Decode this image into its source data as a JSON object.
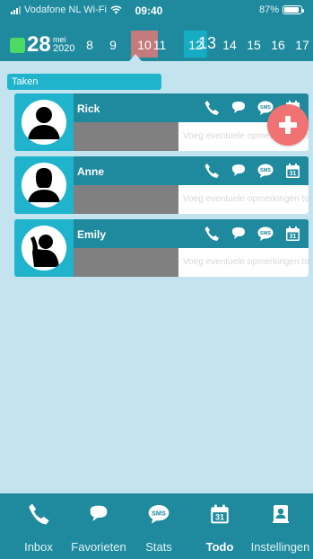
{
  "status": {
    "carrier": "Vodafone NL Wi-Fi",
    "time": "09:40",
    "battery": "87%",
    "battery_level": 0.87
  },
  "date_strip": {
    "today_day": "28",
    "today_month": "mei",
    "today_year": "2020",
    "days": [
      "8",
      "9",
      "10",
      "11",
      "12",
      "13",
      "14",
      "15",
      "16",
      "17"
    ]
  },
  "section": {
    "label": "Taken"
  },
  "contacts": [
    {
      "name": "Rick",
      "note_placeholder": "Voeg eventuele opmerkingen toe"
    },
    {
      "name": "Anne",
      "note_placeholder": "Voeg eventuele opmerkingen toe"
    },
    {
      "name": "Emily",
      "note_placeholder": "Voeg eventuele opmerkingen toe"
    }
  ],
  "icons": {
    "call": "phone-icon",
    "chat": "chat-bubble-icon",
    "sms": "sms-icon",
    "calendar": "calendar-icon",
    "add": "plus-icon",
    "settings": "contact-card-icon"
  },
  "calendar_icon_day": "31",
  "sms_text": "SMS",
  "tabs": [
    {
      "label": "Inbox"
    },
    {
      "label": "Favorieten"
    },
    {
      "label": "Stats"
    },
    {
      "label": "Todo",
      "active": true
    },
    {
      "label": "Instellingen"
    }
  ],
  "colors": {
    "header": "#1f8a9d",
    "accent": "#1fb4cc",
    "background": "#c3e3ef",
    "fab": "#f07273",
    "today": "#4cd964",
    "highlight_red": "#c47b7e"
  }
}
